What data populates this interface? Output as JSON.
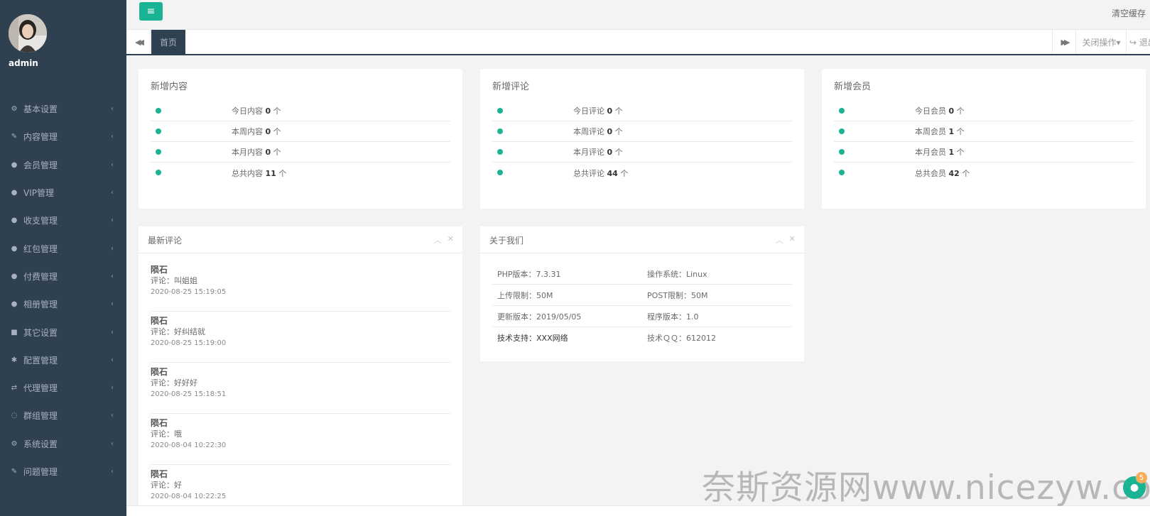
{
  "user": {
    "name": "admin"
  },
  "sidebar": {
    "items": [
      {
        "label": "基本设置",
        "icon": "gear-icon",
        "glyph": "⚙"
      },
      {
        "label": "内容管理",
        "icon": "edit-icon",
        "glyph": "✎"
      },
      {
        "label": "会员管理",
        "icon": "user-icon",
        "glyph": "●"
      },
      {
        "label": "VIP管理",
        "icon": "user-icon",
        "glyph": "●"
      },
      {
        "label": "收支管理",
        "icon": "user-icon",
        "glyph": "●"
      },
      {
        "label": "红包管理",
        "icon": "user-icon",
        "glyph": "●"
      },
      {
        "label": "付费管理",
        "icon": "user-icon",
        "glyph": "●"
      },
      {
        "label": "相册管理",
        "icon": "user-icon",
        "glyph": "●"
      },
      {
        "label": "其它设置",
        "icon": "book-icon",
        "glyph": "■"
      },
      {
        "label": "配置管理",
        "icon": "asterisk-icon",
        "glyph": "✱"
      },
      {
        "label": "代理管理",
        "icon": "exchange-icon",
        "glyph": "⇄"
      },
      {
        "label": "群组管理",
        "icon": "comment-icon",
        "glyph": "◌"
      },
      {
        "label": "系统设置",
        "icon": "cogs-icon",
        "glyph": "⚙"
      },
      {
        "label": "问题管理",
        "icon": "edit-icon",
        "glyph": "✎"
      }
    ]
  },
  "topbar": {
    "menu_glyph": "≡",
    "clear_cache": "清空缓存"
  },
  "tabbar": {
    "left_glyph": "◀◀",
    "active_tab": "首页",
    "right_glyph": "▶▶",
    "close_ops": "关闭操作▾",
    "logout": "↪ 退出"
  },
  "stats": [
    {
      "title": "新增内容",
      "rows": [
        {
          "label": "今日内容",
          "value": "0",
          "unit": "个"
        },
        {
          "label": "本周内容",
          "value": "0",
          "unit": "个"
        },
        {
          "label": "本月内容",
          "value": "0",
          "unit": "个"
        },
        {
          "label": "总共内容",
          "value": "11",
          "unit": "个"
        }
      ]
    },
    {
      "title": "新增评论",
      "rows": [
        {
          "label": "今日评论",
          "value": "0",
          "unit": "个"
        },
        {
          "label": "本周评论",
          "value": "0",
          "unit": "个"
        },
        {
          "label": "本月评论",
          "value": "0",
          "unit": "个"
        },
        {
          "label": "总共评论",
          "value": "44",
          "unit": "个"
        }
      ]
    },
    {
      "title": "新增会员",
      "rows": [
        {
          "label": "今日会员",
          "value": "0",
          "unit": "个"
        },
        {
          "label": "本周会员",
          "value": "1",
          "unit": "个"
        },
        {
          "label": "本月会员",
          "value": "1",
          "unit": "个"
        },
        {
          "label": "总共会员",
          "value": "42",
          "unit": "个"
        }
      ]
    }
  ],
  "comments_panel": {
    "title": "最新评论",
    "collapse_glyph": "︿",
    "close_glyph": "✕",
    "items": [
      {
        "name": "陨石",
        "text": "评论：叫姐姐",
        "date": "2020-08-25 15:19:05"
      },
      {
        "name": "陨石",
        "text": "评论：好纠结就",
        "date": "2020-08-25 15:19:00"
      },
      {
        "name": "陨石",
        "text": "评论：好好好",
        "date": "2020-08-25 15:18:51"
      },
      {
        "name": "陨石",
        "text": "评论：哦",
        "date": "2020-08-04 10:22:30"
      },
      {
        "name": "陨石",
        "text": "评论：好",
        "date": "2020-08-04 10:22:25"
      }
    ]
  },
  "about_panel": {
    "title": "关于我们",
    "collapse_glyph": "︿",
    "close_glyph": "✕",
    "rows": [
      {
        "left": "PHP版本：7.3.31",
        "right": "操作系统：Linux"
      },
      {
        "left": "上传限制：50M",
        "right": "POST限制：50M"
      },
      {
        "left": "更新版本：2019/05/05",
        "right": "程序版本：1.0"
      },
      {
        "left": "技术支持：XXX网络",
        "right": "技术ＱＱ：612012"
      }
    ]
  },
  "watermark": "奈斯资源网www.nicezyw.com",
  "float_badge": "5",
  "colors": {
    "accent": "#1ab394",
    "sidebar": "#2f4050",
    "badge": "#f8ac59"
  }
}
